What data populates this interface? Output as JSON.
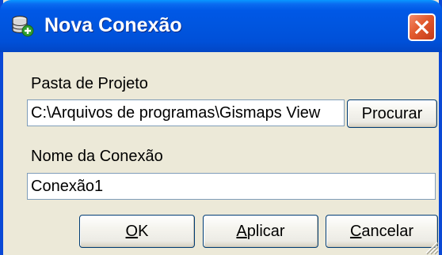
{
  "window": {
    "title": "Nova Conexão",
    "icon": "database-add-icon",
    "close_icon": "close-icon"
  },
  "form": {
    "project_folder_label": "Pasta de Projeto",
    "project_folder_value": "C:\\Arquivos de programas\\Gismaps View",
    "browse_label": "Procurar",
    "connection_name_label": "Nome da Conexão",
    "connection_name_value": "Conexão1"
  },
  "buttons": {
    "ok_label": "OK",
    "apply_label": "Aplicar",
    "cancel_label": "Cancelar"
  },
  "colors": {
    "title_bar": "#0055DF",
    "close_button": "#E25A2E",
    "dialog_background": "#ECE9D8",
    "button_border": "#003C74"
  }
}
